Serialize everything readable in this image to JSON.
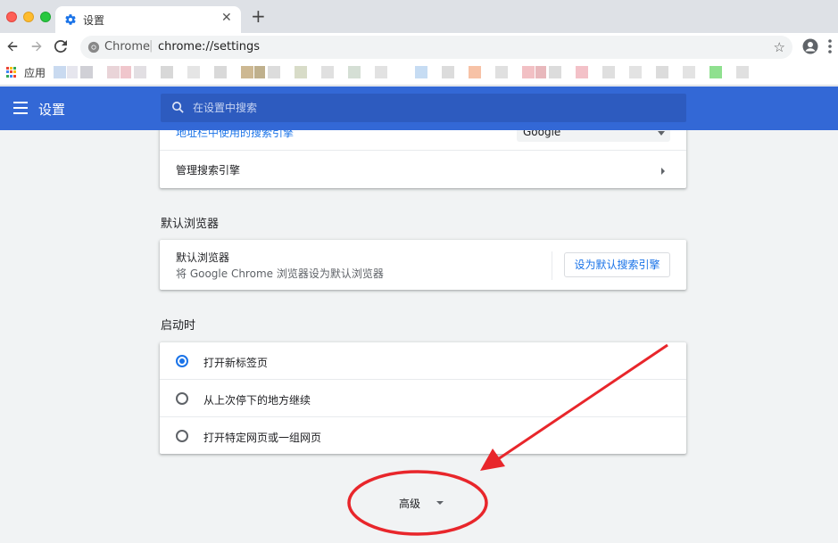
{
  "tab": {
    "title": "设置",
    "close": "✕",
    "new_tab": "+"
  },
  "toolbar": {
    "omnibox_label": "Chrome",
    "separator": "|",
    "url": "chrome://settings",
    "star": "☆"
  },
  "bookmarks": {
    "apps_label": "应用"
  },
  "header": {
    "title": "设置",
    "search_placeholder": "在设置中搜索"
  },
  "search_engine": {
    "partial_label": "地址栏中使用的搜索引擎",
    "selected": "Google",
    "manage_label": "管理搜索引擎"
  },
  "default_browser": {
    "section_title": "默认浏览器",
    "title": "默认浏览器",
    "subtitle": "将 Google Chrome 浏览器设为默认浏览器",
    "button": "设为默认搜索引擎"
  },
  "startup": {
    "section_title": "启动时",
    "options": [
      {
        "label": "打开新标签页",
        "checked": true
      },
      {
        "label": "从上次停下的地方继续",
        "checked": false
      },
      {
        "label": "打开特定网页或一组网页",
        "checked": false
      }
    ]
  },
  "advanced": {
    "label": "高级"
  },
  "colors": {
    "header_blue": "#3368d6",
    "link_blue": "#1a73e8",
    "annotation_red": "#e8262b"
  }
}
